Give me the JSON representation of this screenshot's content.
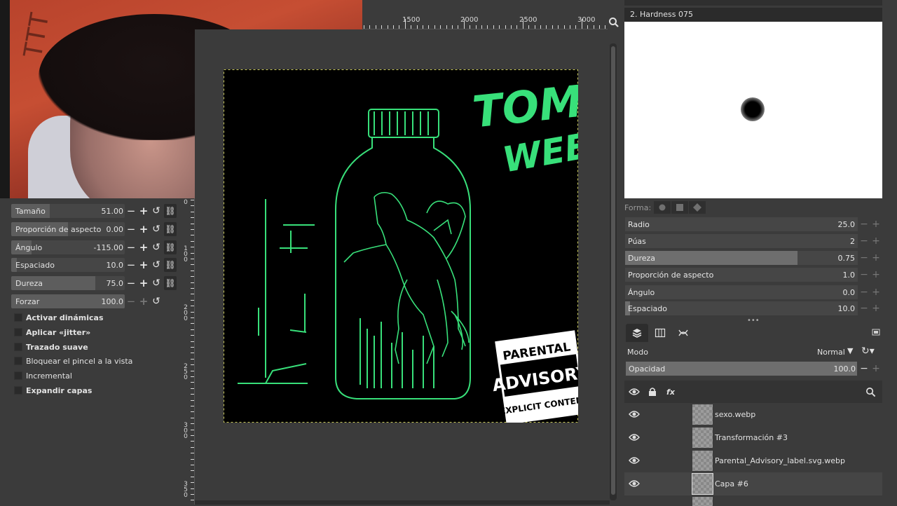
{
  "ruler": {
    "top_labels": [
      "1500",
      "2000",
      "2500",
      "3000"
    ],
    "left_labels": [
      "0",
      "1 0 0",
      "2 0 0",
      "2 5 0",
      "3 0 0",
      "3 5 0"
    ]
  },
  "tool_options": {
    "sliders": [
      {
        "label": "Tamaño",
        "value": "51.00",
        "fill": 0.34
      },
      {
        "label": "Proporción de aspecto",
        "value": "0.00",
        "fill": 0.5
      },
      {
        "label": "Ángulo",
        "value": "-115.00",
        "fill": 0.18
      },
      {
        "label": "Espaciado",
        "value": "10.0",
        "fill": 0.05
      },
      {
        "label": "Dureza",
        "value": "75.0",
        "fill": 0.75
      },
      {
        "label": "Forzar",
        "value": "100.0",
        "fill": 1.0
      }
    ],
    "checkboxes": [
      {
        "label": "Activar dinámicas",
        "bold": true
      },
      {
        "label": "Aplicar «jitter»",
        "bold": true
      },
      {
        "label": "Trazado suave",
        "bold": true
      },
      {
        "label": "Bloquear el pincel a la vista",
        "bold": false
      },
      {
        "label": "Incremental",
        "bold": false
      },
      {
        "label": "Expandir capas",
        "bold": true
      }
    ]
  },
  "artwork": {
    "title_line1": "TOMMY",
    "title_line2": "WEED",
    "parental": "PARENTAL",
    "advisory": "ADVISORY",
    "explicit": "EXPLICIT CONTENT"
  },
  "brush_panel": {
    "title": "2. Hardness 075",
    "forma_label": "Forma:",
    "sliders": [
      {
        "label": "Radio",
        "value": "25.0",
        "fill": 0.0
      },
      {
        "label": "Púas",
        "value": "2",
        "fill": 0.0
      },
      {
        "label": "Dureza",
        "value": "0.75",
        "fill": 0.74
      },
      {
        "label": "Proporción de aspecto",
        "value": "1.0",
        "fill": 0.0
      },
      {
        "label": "Ángulo",
        "value": "0.0",
        "fill": 0.0
      },
      {
        "label": "Espaciado",
        "value": "10.0",
        "fill": 0.02
      }
    ]
  },
  "layers_panel": {
    "mode_label": "Modo",
    "mode_value": "Normal",
    "opacity_label": "Opacidad",
    "opacity_value": "100.0",
    "layers": [
      {
        "name": "sexo.webp",
        "selected": false
      },
      {
        "name": "Transformación #3",
        "selected": false
      },
      {
        "name": "Parental_Advisory_label.svg.webp",
        "selected": false
      },
      {
        "name": "Capa #6",
        "selected": true
      }
    ]
  },
  "colors": {
    "accent_green": "#38e07a",
    "panel_bg": "#3b3b3b",
    "canvas_black": "#000000"
  }
}
